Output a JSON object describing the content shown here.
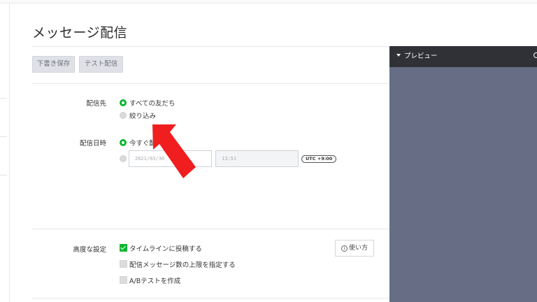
{
  "page": {
    "title": "メッセージ配信"
  },
  "toolbar": {
    "save_draft_label": "下書き保存",
    "test_send_label": "テスト配信"
  },
  "form": {
    "recipients": {
      "label": "配信先",
      "options": [
        {
          "label": "すべての友だち",
          "selected": true
        },
        {
          "label": "絞り込み",
          "selected": false
        }
      ]
    },
    "schedule": {
      "label": "配信日時",
      "options": [
        {
          "label": "今すぐ配",
          "selected": true
        },
        {
          "label": "",
          "selected": false
        }
      ],
      "date_value": "2021/03/30",
      "time_value": "13:51",
      "timezone_badge": "UTC +9:00"
    },
    "advanced": {
      "label": "高度な設定",
      "checkboxes": [
        {
          "label": "タイムラインに投稿する",
          "checked": true
        },
        {
          "label": "配信メッセージ数の上限を指定する",
          "checked": false
        },
        {
          "label": "A/Bテストを作成",
          "checked": false
        }
      ],
      "howto_label": "使い方",
      "howto_icon": "info-icon"
    }
  },
  "preview": {
    "title": "プレビュー"
  },
  "annotation": {
    "icon": "red-arrow-pointer",
    "color": "#f01e1e"
  },
  "colors": {
    "accent_green": "#08b72e",
    "preview_bg": "#666d85",
    "preview_header": "#2f3136",
    "button_bg": "#dfe1e6"
  }
}
